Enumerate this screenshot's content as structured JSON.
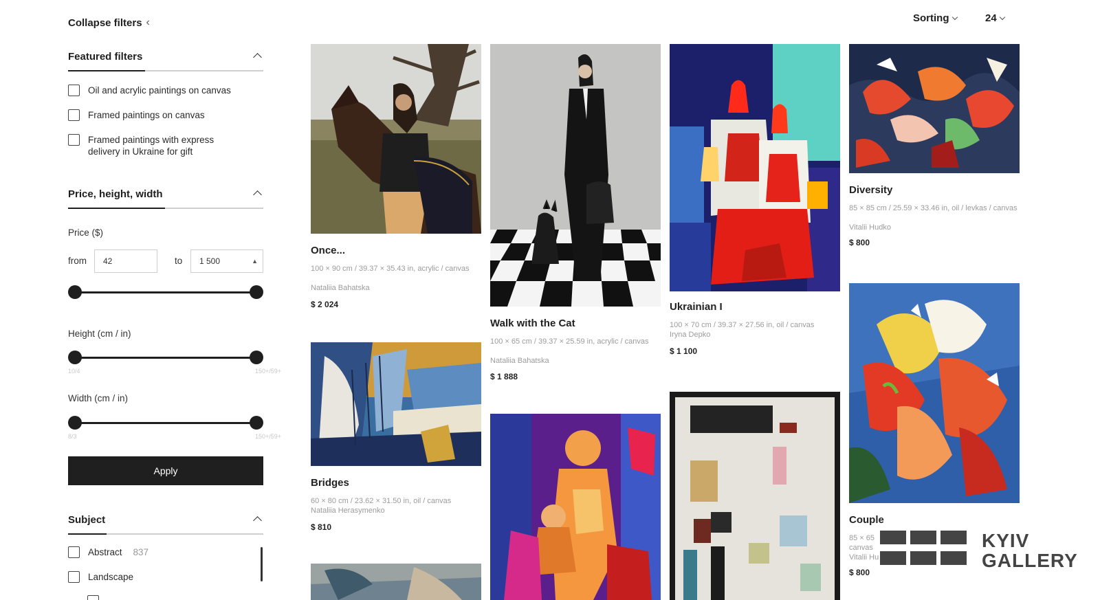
{
  "sidebar": {
    "collapse_label": "Collapse filters",
    "featured": {
      "title": "Featured filters",
      "options": [
        {
          "label": "Oil and acrylic paintings on canvas"
        },
        {
          "label": "Framed paintings on canvas"
        },
        {
          "label": "Framed paintings with express delivery in Ukraine for gift"
        }
      ]
    },
    "dimensions": {
      "title": "Price, height, width",
      "price_label": "Price ($)",
      "from_label": "from",
      "to_label": "to",
      "from_value": "42",
      "to_value": "1 500",
      "height_label": "Height (cm / in)",
      "height_min": "10/4",
      "height_max": "150+/59+",
      "width_label": "Width (cm / in)",
      "width_min": "8/3",
      "width_max": "150+/59+"
    },
    "apply_label": "Apply",
    "subject": {
      "title": "Subject",
      "options": [
        {
          "label": "Abstract",
          "count": "837"
        },
        {
          "label": "Landscape",
          "count": ""
        }
      ]
    }
  },
  "toolbar": {
    "sorting_label": "Sorting",
    "per_page": "24"
  },
  "artworks": [
    {
      "title": "Once...",
      "specs": "100 × 90 cm / 39.37 × 35.43 in, acrylic / canvas",
      "artist": "Nataliia Bahatska",
      "price": "$ 2 024"
    },
    {
      "title": "Walk with the Cat",
      "specs": "100 × 65 cm / 39.37 × 25.59 in, acrylic / canvas",
      "artist": "Nataliia Bahatska",
      "price": "$ 1 888"
    },
    {
      "title": "Ukrainian I",
      "specs": "100 × 70 cm / 39.37 × 27.56 in, oil / canvas",
      "artist": "Iryna Depko",
      "price": "$ 1 100"
    },
    {
      "title": "Diversity",
      "specs": "85 × 85 cm / 25.59 × 33.46 in, oil / levkas / canvas",
      "artist": "Vitalii Hudko",
      "price": "$ 800"
    },
    {
      "title": "Bridges",
      "specs": "60 × 80 cm / 23.62 × 31.50 in, oil / canvas",
      "artist": "Nataliia Herasymenko",
      "price": "$ 810"
    },
    {
      "title": "Couple",
      "specs": "85 × 65",
      "specs2": "canvas",
      "artist": "Vitalii Hu",
      "price": "$ 800"
    }
  ],
  "logo": {
    "line1": "KYIV",
    "line2": "GALLERY"
  },
  "colors": {
    "text": "#1f1f1f",
    "muted": "#9b9b9b",
    "button": "#1f1f1f",
    "border": "#cfcfcf"
  }
}
